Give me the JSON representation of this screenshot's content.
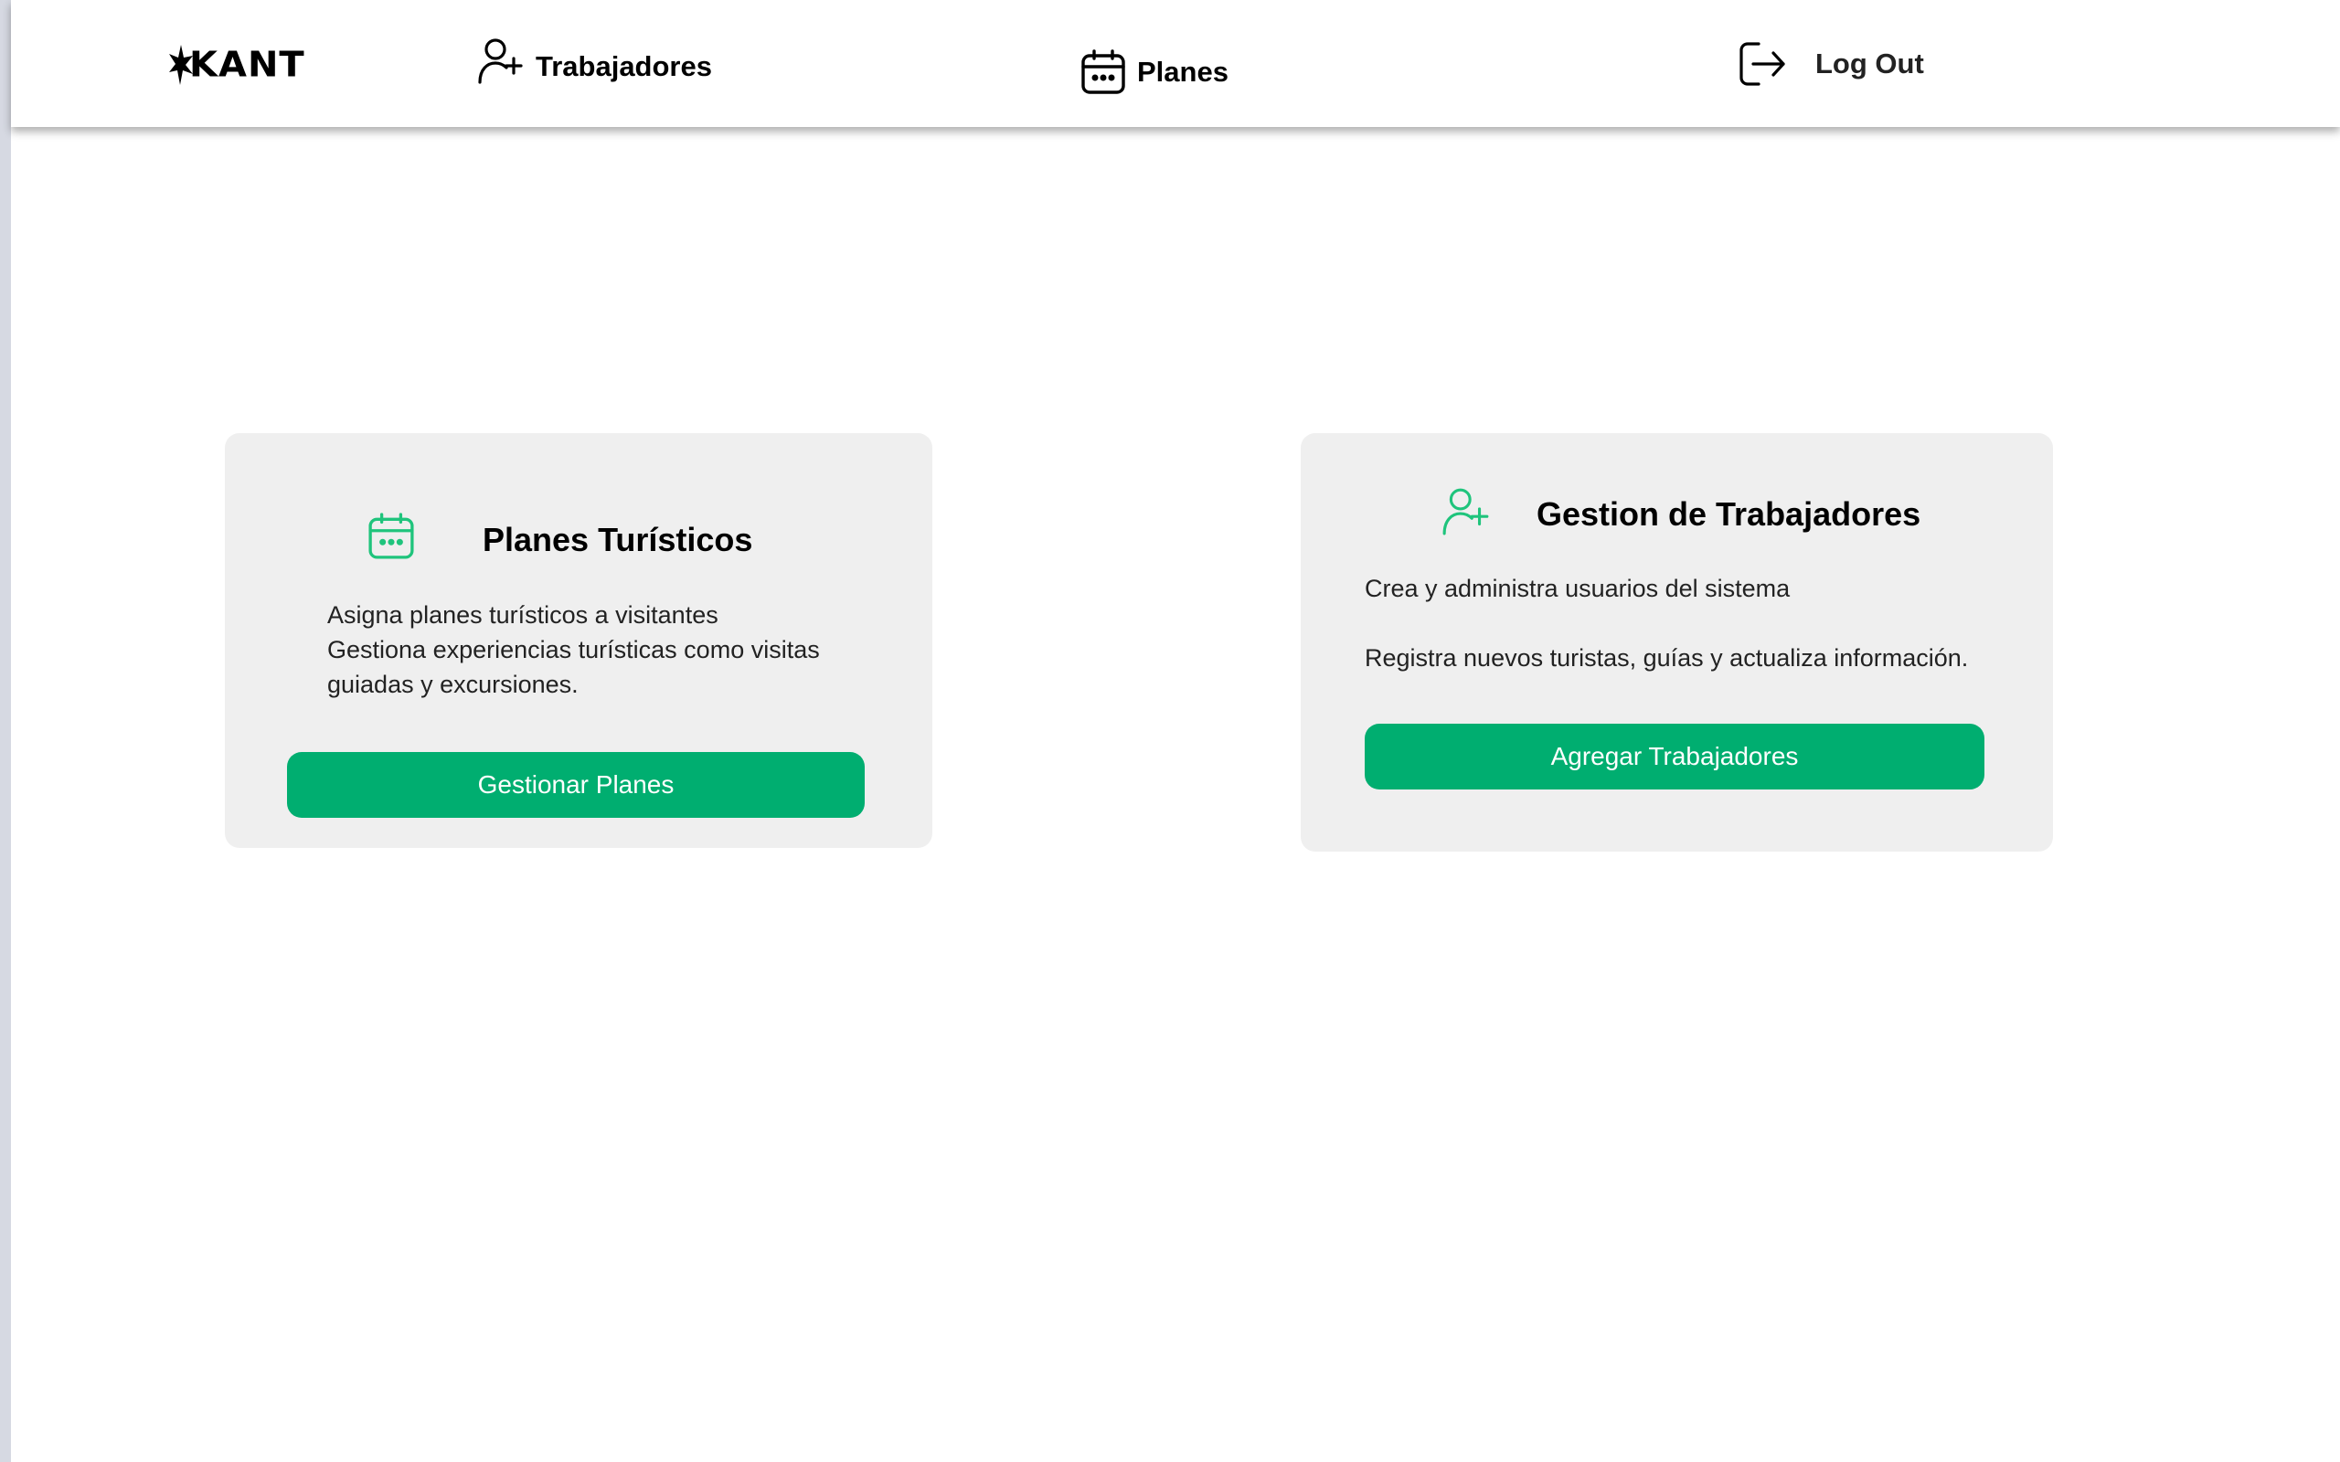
{
  "navbar": {
    "logo_text": "KANT",
    "items": [
      {
        "label": "Trabajadores",
        "icon": "user-plus-icon"
      },
      {
        "label": "Planes",
        "icon": "calendar-icon"
      },
      {
        "label": "Log Out",
        "icon": "logout-icon"
      }
    ]
  },
  "cards": [
    {
      "title": "Planes Turísticos",
      "icon": "calendar-icon",
      "description_lines": [
        "Asigna planes turísticos a visitantes",
        "Gestiona experiencias turísticas como visitas",
        "guiadas y excursiones."
      ],
      "button_label": "Gestionar Planes"
    },
    {
      "title": "Gestion de Trabajadores",
      "icon": "user-plus-icon",
      "description_lines": [
        "Crea y administra usuarios del sistema",
        "Registra nuevos turistas, guías y actualiza información."
      ],
      "button_label": "Agregar Trabajadores"
    }
  ],
  "colors": {
    "accent": "#00ae70",
    "card_background": "#efefef",
    "icon_green": "#1fc47c"
  }
}
